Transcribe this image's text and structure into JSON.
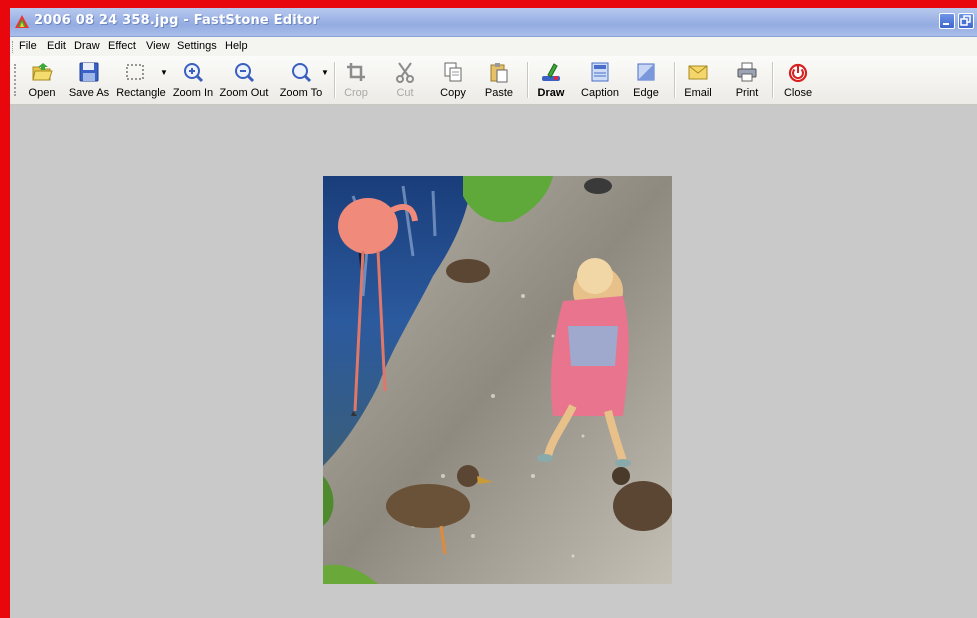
{
  "window": {
    "title": "2006 08 24 358.jpg - FastStone Editor"
  },
  "menu": {
    "items": [
      "File",
      "Edit",
      "Draw",
      "Effect",
      "View",
      "Settings",
      "Help"
    ]
  },
  "toolbar": {
    "open": "Open",
    "save_as": "Save As",
    "rectangle": "Rectangle",
    "zoom_in": "Zoom In",
    "zoom_out": "Zoom Out",
    "zoom_to": "Zoom To",
    "crop": "Crop",
    "cut": "Cut",
    "copy": "Copy",
    "paste": "Paste",
    "draw": "Draw",
    "caption": "Caption",
    "edge": "Edge",
    "email": "Email",
    "print": "Print",
    "close": "Close"
  },
  "icons": {
    "app": "faststone-app-icon",
    "minimize": "minimize-icon",
    "restore": "restore-icon"
  },
  "colors": {
    "frame_border": "#e8070c",
    "canvas": "#c9c9c9",
    "titlebar": "#9fb5e6"
  }
}
